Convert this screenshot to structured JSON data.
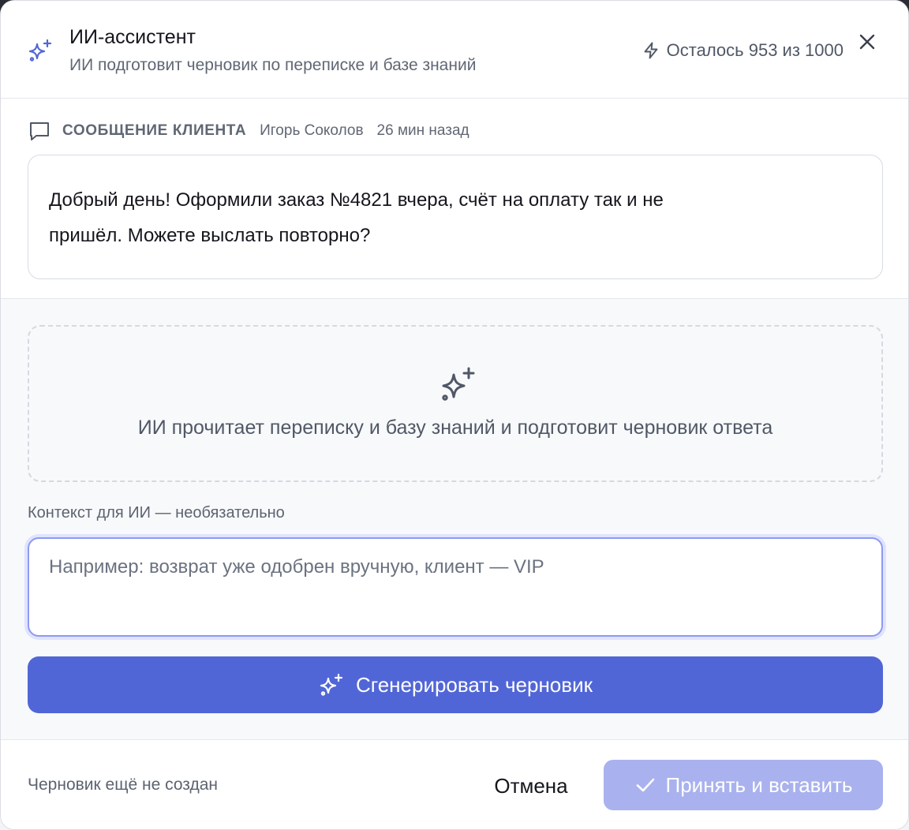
{
  "header": {
    "title": "ИИ-ассистент",
    "subtitle": "ИИ подготовит черновик по переписке и базе знаний",
    "quota_text": "Осталось 953 из 1000",
    "icon": "sparkles-icon",
    "close_icon": "close-icon"
  },
  "message": {
    "label": "СООБЩЕНИЕ КЛИЕНТА",
    "author": "Игорь Соколов",
    "time": "26 мин назад",
    "text_line1": "Добрый день! Оформили заказ №4821 вчера, счёт на оплату так и не",
    "text_line2": "пришёл. Можете выслать повторно?"
  },
  "placeholder": {
    "text": "ИИ прочитает переписку и базу знаний и подготовит черновик ответа"
  },
  "context": {
    "label": "Контекст для ИИ — необязательно",
    "value": "",
    "placeholder": "Например: возврат уже одобрен вручную, клиент — VIP"
  },
  "generate_button": {
    "label": "Сгенерировать черновик"
  },
  "footer": {
    "status": "Черновик ещё не создан",
    "cancel_label": "Отмена",
    "accept_label": "Принять и вставить"
  },
  "colors": {
    "accent": "#5166d6",
    "accent_disabled": "#a9b2ee",
    "focus_ring": "#8e99f3"
  }
}
